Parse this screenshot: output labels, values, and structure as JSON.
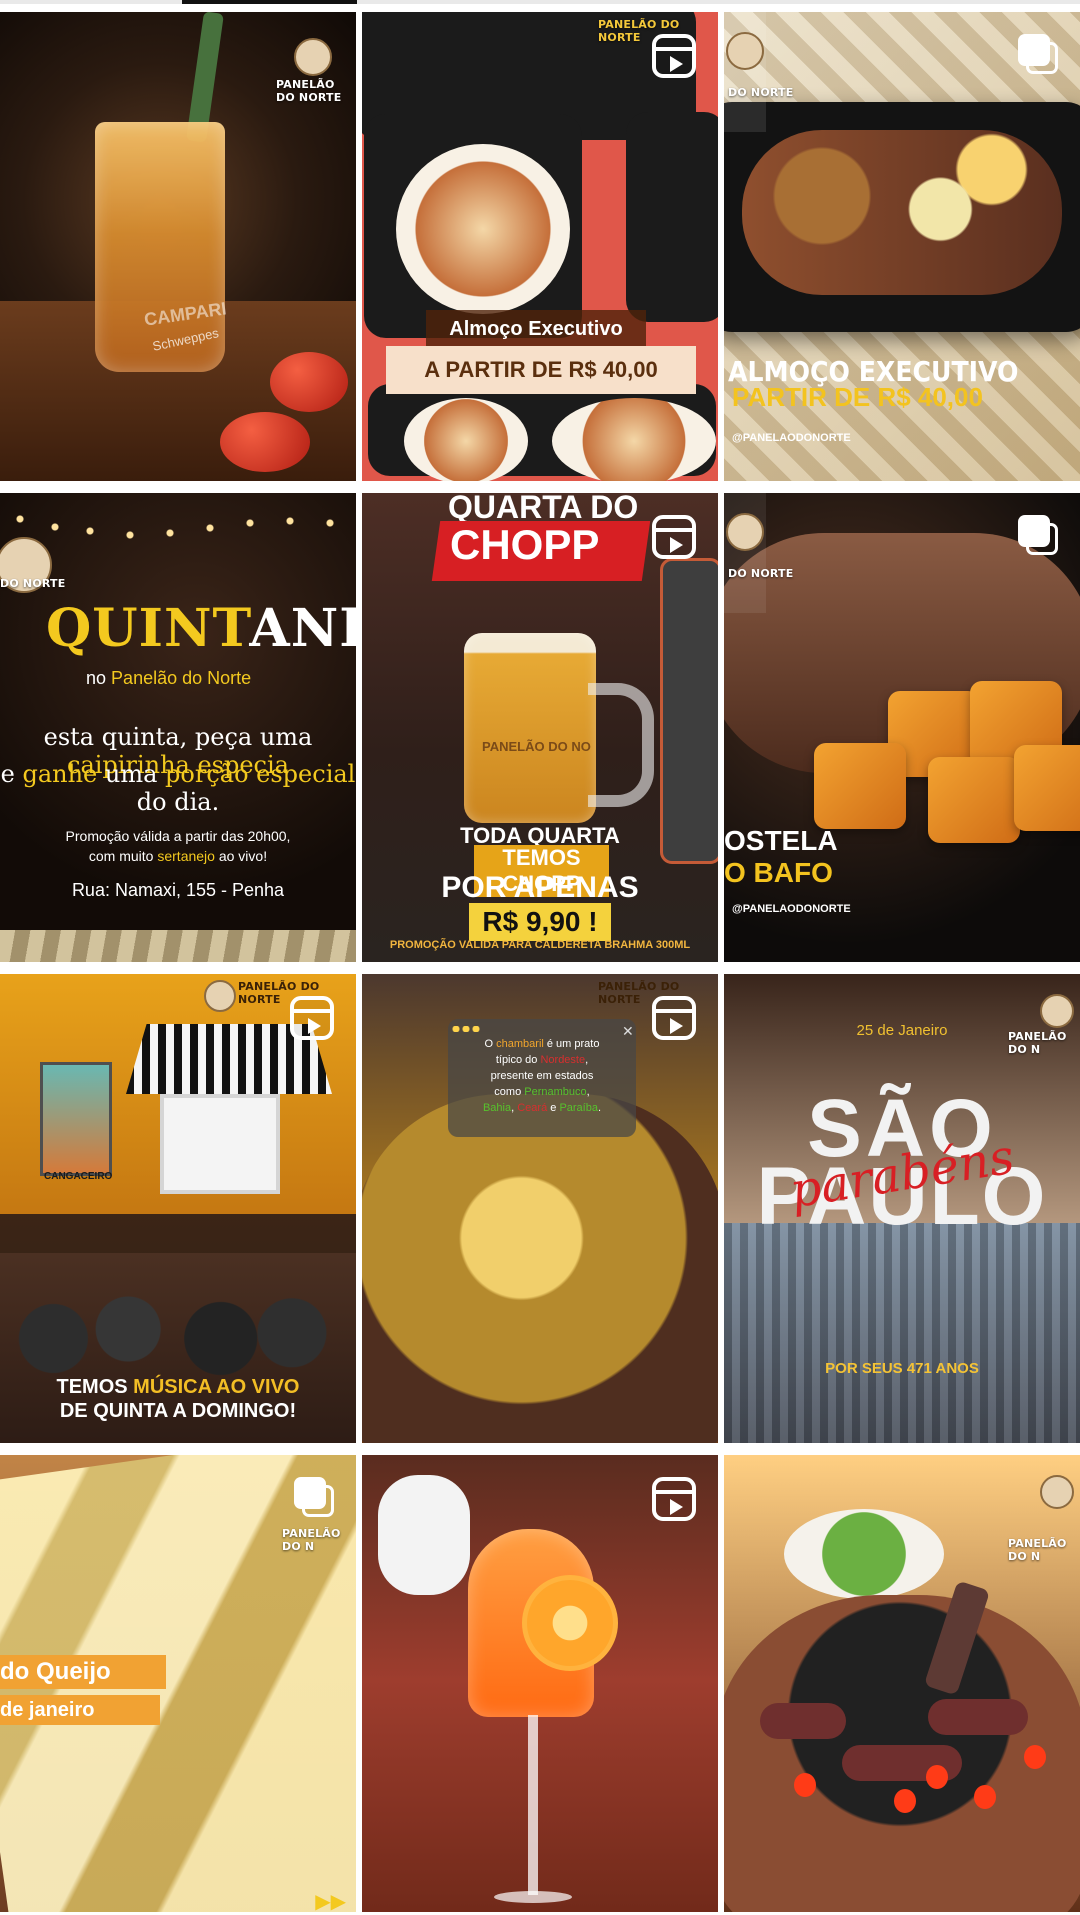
{
  "tabs": {
    "active_index": 1
  },
  "grid": {
    "posts": [
      {
        "type": "image",
        "brand": "PANELÃO DO NORTE",
        "glass_brand": "CAMPARI",
        "glass_brand_sub": "Schweppes"
      },
      {
        "type": "reel",
        "brand": "PANELÃO DO NORTE",
        "title": "Almoço Executivo",
        "price": "A PARTIR DE R$ 40,00"
      },
      {
        "type": "carousel",
        "brand": "DO NORTE",
        "title": "ALMOÇO EXECUTIVO",
        "price": "PARTIR DE R$ 40,00",
        "handle": "@PANELAODONORTE"
      },
      {
        "type": "image",
        "brand": "DO NORTE",
        "title_gold": "QUINT",
        "title_white": "ANEJA",
        "subtitle_prefix": "no",
        "subtitle_brand": "Panelão do Norte",
        "line1_prefix": "esta quinta, peça uma ",
        "line1_highlight": "caipirinha especia",
        "line2_prefix": "e ",
        "line2_highlight1": "ganhe",
        "line2_middle": " uma ",
        "line2_highlight2": "porção especial",
        "line2_suffix": " do dia.",
        "promo_line1": "Promoção válida a partir das 20h00,",
        "promo_line2_prefix": "com muito ",
        "promo_line2_highlight": "sertanejo",
        "promo_line2_suffix": " ao vivo!",
        "address": "Rua: Namaxi, 155 - Penha"
      },
      {
        "type": "reel",
        "top_text": "QUARTA DO",
        "band_text": "CHOPP",
        "mug_text": "PANELÃO DO NO",
        "line1": "TODA QUARTA",
        "line2": "TEMOS CHOPP",
        "line3": "POR APENAS",
        "price": "R$ 9,90 !",
        "footer": "PROMOÇÃO VALIDA PARA CALDERETA BRAHMA 300ML"
      },
      {
        "type": "carousel",
        "brand": "DO NORTE",
        "title1": "OSTELA",
        "title2": "O BAFO",
        "handle": "@PANELAODONORTE"
      },
      {
        "type": "reel",
        "brand": "PANELÃO DO NORTE",
        "poster_text": "CANGACEIRO",
        "line1_prefix": "TEMOS ",
        "line1_highlight": "MÚSICA AO VIVO",
        "line2": "DE QUINTA A DOMINGO!"
      },
      {
        "type": "reel",
        "brand": "PANELÃO DO NORTE",
        "card_line1_prefix": "O ",
        "card_line1_highlight": "chambaril",
        "card_line1_suffix": " é um prato",
        "card_line2_prefix": "típico do ",
        "card_line2_highlight": "Nordeste",
        "card_line2_suffix": ",",
        "card_line3": "presente em estados",
        "card_line4_prefix": "como ",
        "card_line4_highlight": "Pernambuco",
        "card_line4_suffix": ",",
        "card_line5_state1": "Bahia",
        "card_line5_sep1": ", ",
        "card_line5_state2": "Ceará",
        "card_line5_sep2": " e ",
        "card_line5_state3": "Paraíba",
        "card_line5_suffix": "."
      },
      {
        "type": "image",
        "brand": "PANELÃO DO N",
        "date": "25 de Janeiro",
        "sao": "SÃO",
        "paulo": "PAULO",
        "parabens": "parabéns",
        "sub": "POR SEUS 471 ANOS"
      },
      {
        "type": "carousel",
        "brand": "PANELÃO DO N",
        "line1": "do Queijo",
        "line2": "de janeiro",
        "arrows": "▶▶"
      },
      {
        "type": "reel"
      },
      {
        "type": "image",
        "brand": "PANELÃO DO N"
      }
    ]
  }
}
